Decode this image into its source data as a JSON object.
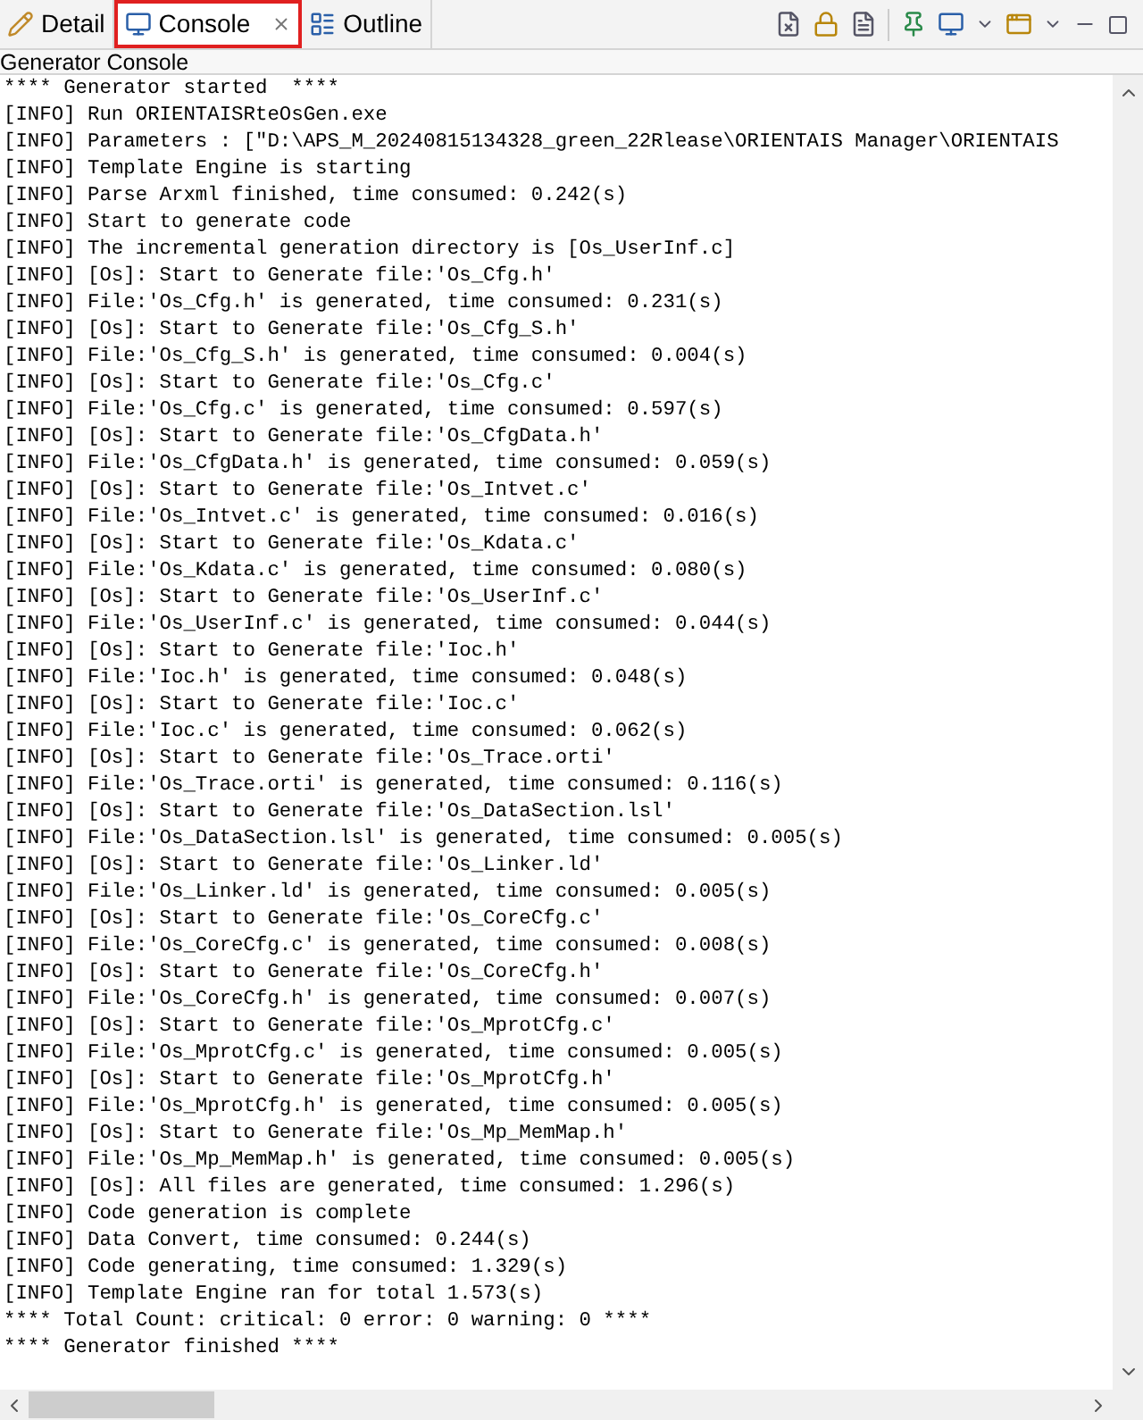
{
  "tabs": [
    {
      "label": "Detail",
      "selected": false
    },
    {
      "label": "Console",
      "selected": true
    },
    {
      "label": "Outline",
      "selected": false
    }
  ],
  "console": {
    "title": "Generator Console",
    "lines": [
      "**** Generator started  ****",
      "[INFO] Run ORIENTAISRteOsGen.exe",
      "[INFO] Parameters : [\"D:\\APS_M_20240815134328_green_22Rlease\\ORIENTAIS Manager\\ORIENTAIS",
      "[INFO] Template Engine is starting",
      "[INFO] Parse Arxml finished, time consumed: 0.242(s)",
      "[INFO] Start to generate code",
      "[INFO] The incremental generation directory is [Os_UserInf.c]",
      "[INFO] [Os]: Start to Generate file:'Os_Cfg.h'",
      "[INFO] File:'Os_Cfg.h' is generated, time consumed: 0.231(s)",
      "[INFO] [Os]: Start to Generate file:'Os_Cfg_S.h'",
      "[INFO] File:'Os_Cfg_S.h' is generated, time consumed: 0.004(s)",
      "[INFO] [Os]: Start to Generate file:'Os_Cfg.c'",
      "[INFO] File:'Os_Cfg.c' is generated, time consumed: 0.597(s)",
      "[INFO] [Os]: Start to Generate file:'Os_CfgData.h'",
      "[INFO] File:'Os_CfgData.h' is generated, time consumed: 0.059(s)",
      "[INFO] [Os]: Start to Generate file:'Os_Intvet.c'",
      "[INFO] File:'Os_Intvet.c' is generated, time consumed: 0.016(s)",
      "[INFO] [Os]: Start to Generate file:'Os_Kdata.c'",
      "[INFO] File:'Os_Kdata.c' is generated, time consumed: 0.080(s)",
      "[INFO] [Os]: Start to Generate file:'Os_UserInf.c'",
      "[INFO] File:'Os_UserInf.c' is generated, time consumed: 0.044(s)",
      "[INFO] [Os]: Start to Generate file:'Ioc.h'",
      "[INFO] File:'Ioc.h' is generated, time consumed: 0.048(s)",
      "[INFO] [Os]: Start to Generate file:'Ioc.c'",
      "[INFO] File:'Ioc.c' is generated, time consumed: 0.062(s)",
      "[INFO] [Os]: Start to Generate file:'Os_Trace.orti'",
      "[INFO] File:'Os_Trace.orti' is generated, time consumed: 0.116(s)",
      "[INFO] [Os]: Start to Generate file:'Os_DataSection.lsl'",
      "[INFO] File:'Os_DataSection.lsl' is generated, time consumed: 0.005(s)",
      "[INFO] [Os]: Start to Generate file:'Os_Linker.ld'",
      "[INFO] File:'Os_Linker.ld' is generated, time consumed: 0.005(s)",
      "[INFO] [Os]: Start to Generate file:'Os_CoreCfg.c'",
      "[INFO] File:'Os_CoreCfg.c' is generated, time consumed: 0.008(s)",
      "[INFO] [Os]: Start to Generate file:'Os_CoreCfg.h'",
      "[INFO] File:'Os_CoreCfg.h' is generated, time consumed: 0.007(s)",
      "[INFO] [Os]: Start to Generate file:'Os_MprotCfg.c'",
      "[INFO] File:'Os_MprotCfg.c' is generated, time consumed: 0.005(s)",
      "[INFO] [Os]: Start to Generate file:'Os_MprotCfg.h'",
      "[INFO] File:'Os_MprotCfg.h' is generated, time consumed: 0.005(s)",
      "[INFO] [Os]: Start to Generate file:'Os_Mp_MemMap.h'",
      "[INFO] File:'Os_Mp_MemMap.h' is generated, time consumed: 0.005(s)",
      "[INFO] [Os]: All files are generated, time consumed: 1.296(s)",
      "[INFO] Code generation is complete",
      "[INFO] Data Convert, time consumed: 0.244(s)",
      "[INFO] Code generating, time consumed: 1.329(s)",
      "[INFO] Template Engine ran for total 1.573(s)",
      "**** Total Count: critical: 0 error: 0 warning: 0 ****",
      "**** Generator finished ****"
    ]
  }
}
